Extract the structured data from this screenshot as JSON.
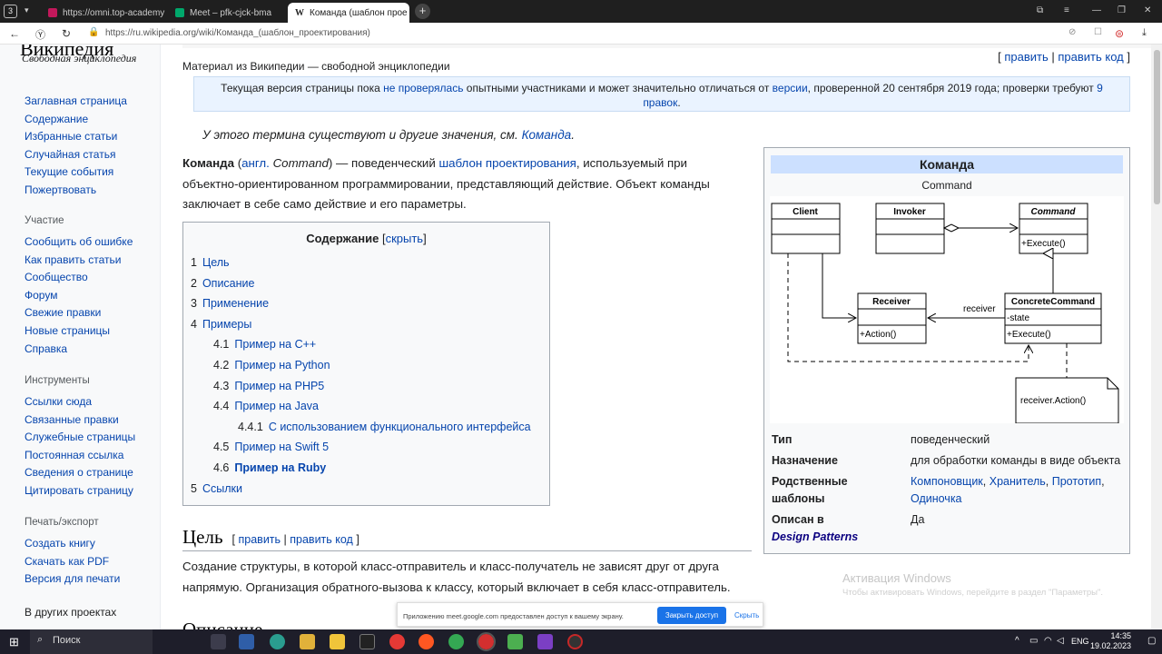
{
  "browser": {
    "tab_count": "3",
    "tabs": [
      {
        "label": "https://omni.top-academy",
        "active": false
      },
      {
        "label": "Meet – pfk-cjck-bma",
        "active": false
      },
      {
        "label": "Команда (шаблон прое",
        "active": true
      }
    ],
    "url": "https://ru.wikipedia.org/wiki/Команда_(шаблон_проектирования)"
  },
  "sidebar": {
    "logo_text": "Википедия",
    "logo_subtitle": "Свободная энциклопедия",
    "nav": [
      "Заглавная страница",
      "Содержание",
      "Избранные статьи",
      "Случайная статья",
      "Текущие события",
      "Пожертвовать"
    ],
    "participation_heading": "Участие",
    "participation": [
      "Сообщить об ошибке",
      "Как править статьи",
      "Сообщество",
      "Форум",
      "Свежие правки",
      "Новые страницы",
      "Справка"
    ],
    "tools_heading": "Инструменты",
    "tools": [
      "Ссылки сюда",
      "Связанные правки",
      "Служебные страницы",
      "Постоянная ссылка",
      "Сведения о странице",
      "Цитировать страницу"
    ],
    "print_heading": "Печать/экспорт",
    "print": [
      "Создать книгу",
      "Скачать как PDF",
      "Версия для печати"
    ],
    "other_heading": "В других проектах"
  },
  "article": {
    "from": "Материал из Википедии — свободной энциклопедии",
    "edit": "править",
    "edit_code": "править код",
    "notice_1": "Текущая версия страницы пока ",
    "notice_link1": "не проверялась",
    "notice_2": " опытными участниками и может значительно отличаться от ",
    "notice_link2": "версии",
    "notice_3": ", проверенной 20 сентября 2019 года; проверки требуют ",
    "notice_link3": "9 правок",
    "notice_4": ".",
    "hatnote_text": "У этого термина существуют и другие значения, см. ",
    "hatnote_link": "Команда",
    "intro_bold": "Команда",
    "intro_a": " (",
    "intro_lang": "англ.",
    "intro_term": " Command",
    "intro_b": ") — поведенческий ",
    "intro_link": "шаблон проектирования",
    "intro_c": ", используемый при объектно-ориентированном программировании, представляющий действие. Объект команды заключает в себе само действие и его параметры.",
    "toc_title": "Содержание",
    "toc_hide": "скрыть",
    "toc": [
      {
        "num": "1",
        "label": "Цель",
        "level": 1
      },
      {
        "num": "2",
        "label": "Описание",
        "level": 1
      },
      {
        "num": "3",
        "label": "Применение",
        "level": 1
      },
      {
        "num": "4",
        "label": "Примеры",
        "level": 1
      },
      {
        "num": "4.1",
        "label": "Пример на C++",
        "level": 2
      },
      {
        "num": "4.2",
        "label": "Пример на Python",
        "level": 2
      },
      {
        "num": "4.3",
        "label": "Пример на PHP5",
        "level": 2
      },
      {
        "num": "4.4",
        "label": "Пример на Java",
        "level": 2
      },
      {
        "num": "4.4.1",
        "label": "С использованием функционального интерфейса",
        "level": 3
      },
      {
        "num": "4.5",
        "label": "Пример на Swift 5",
        "level": 2
      },
      {
        "num": "4.6",
        "label": "Пример на Ruby",
        "level": 2
      },
      {
        "num": "5",
        "label": "Ссылки",
        "level": 1
      }
    ],
    "section_goal": "Цель",
    "goal_text": "Создание структуры, в которой класс-отправитель и класс-получатель не зависят друг от друга напрямую. Организация обратного-вызова к классу, который включает в себя класс-отправитель.",
    "section_next": "Описание"
  },
  "infobox": {
    "title": "Команда",
    "subtitle": "Command",
    "uml": {
      "client": "Client",
      "invoker": "Invoker",
      "command": "Command",
      "command_op": "+Execute()",
      "receiver": "Receiver",
      "receiver_op": "+Action()",
      "concrete": "ConcreteCommand",
      "concrete_attr": "-state",
      "concrete_op": "+Execute()",
      "assoc_label": "receiver",
      "note": "receiver.Action()"
    },
    "type_label": "Тип",
    "type_value": "поведенческий",
    "purpose_label": "Назначение",
    "purpose_value": "для обработки команды в виде объекта",
    "related_label_1": "Родственные",
    "related_label_2": "шаблоны",
    "related_1": "Компоновщик",
    "related_2": "Хранитель",
    "related_3": "Прототип",
    "related_4": "Одиночка",
    "described_label": "Описан в",
    "described_book": "Design Patterns",
    "described_value": "Да"
  },
  "overlay": {
    "activation_title": "Активация Windows",
    "activation_text": "Чтобы активировать Windows, перейдите в раздел \"Параметры\".",
    "meet_text": "Приложению meet.google.com предоставлен доступ к вашему экрану.",
    "meet_stop": "Закрыть доступ",
    "meet_hide": "Скрыть"
  },
  "taskbar": {
    "search": "Поиск",
    "lang": "ENG",
    "time": "14:35",
    "date": "19.02.2023"
  },
  "colors": {
    "link": "#0645ad",
    "infobox_title_bg": "#cce0ff",
    "notice_bg": "#eaf3ff"
  }
}
